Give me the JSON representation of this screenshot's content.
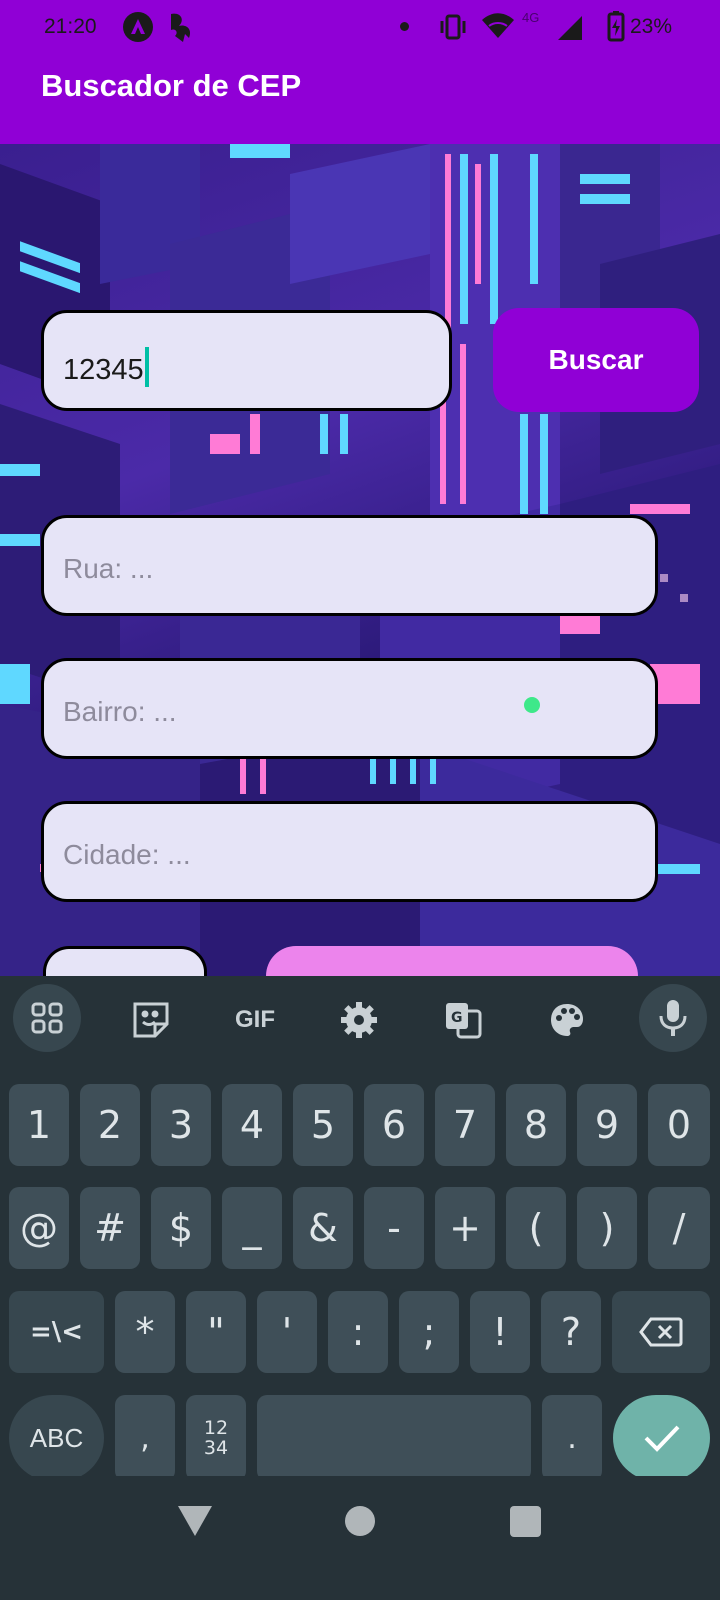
{
  "status_bar": {
    "time": "21:20",
    "network": "4G",
    "battery": "23%"
  },
  "app": {
    "title": "Buscador de CEP"
  },
  "form": {
    "cep_value": "12345",
    "search_button": "Buscar",
    "rua_placeholder": "Rua: ...",
    "bairro_placeholder": "Bairro: ...",
    "cidade_placeholder": "Cidade: ..."
  },
  "keyboard": {
    "toolbar": [
      "apps-grid-icon",
      "sticker-icon",
      "GIF",
      "settings-icon",
      "translate-icon",
      "palette-icon",
      "mic-icon"
    ],
    "gif_label": "GIF",
    "row1": [
      "1",
      "2",
      "3",
      "4",
      "5",
      "6",
      "7",
      "8",
      "9",
      "0"
    ],
    "row2": [
      "@",
      "#",
      "$",
      "_",
      "&",
      "-",
      "+",
      "(",
      ")",
      "/"
    ],
    "row3": [
      "=\\<",
      "*",
      "\"",
      "'",
      ":",
      ";",
      "!",
      "?"
    ],
    "row4": {
      "abc": "ABC",
      "comma": ",",
      "numpad_top": "12",
      "numpad_bottom": "34",
      "period": "."
    }
  },
  "colors": {
    "primary": "#9000d6",
    "field_bg": "#e6e4f7",
    "pink_button": "#ec84ec",
    "keyboard_bg": "#263238",
    "enter_key": "#6fb3a9"
  }
}
